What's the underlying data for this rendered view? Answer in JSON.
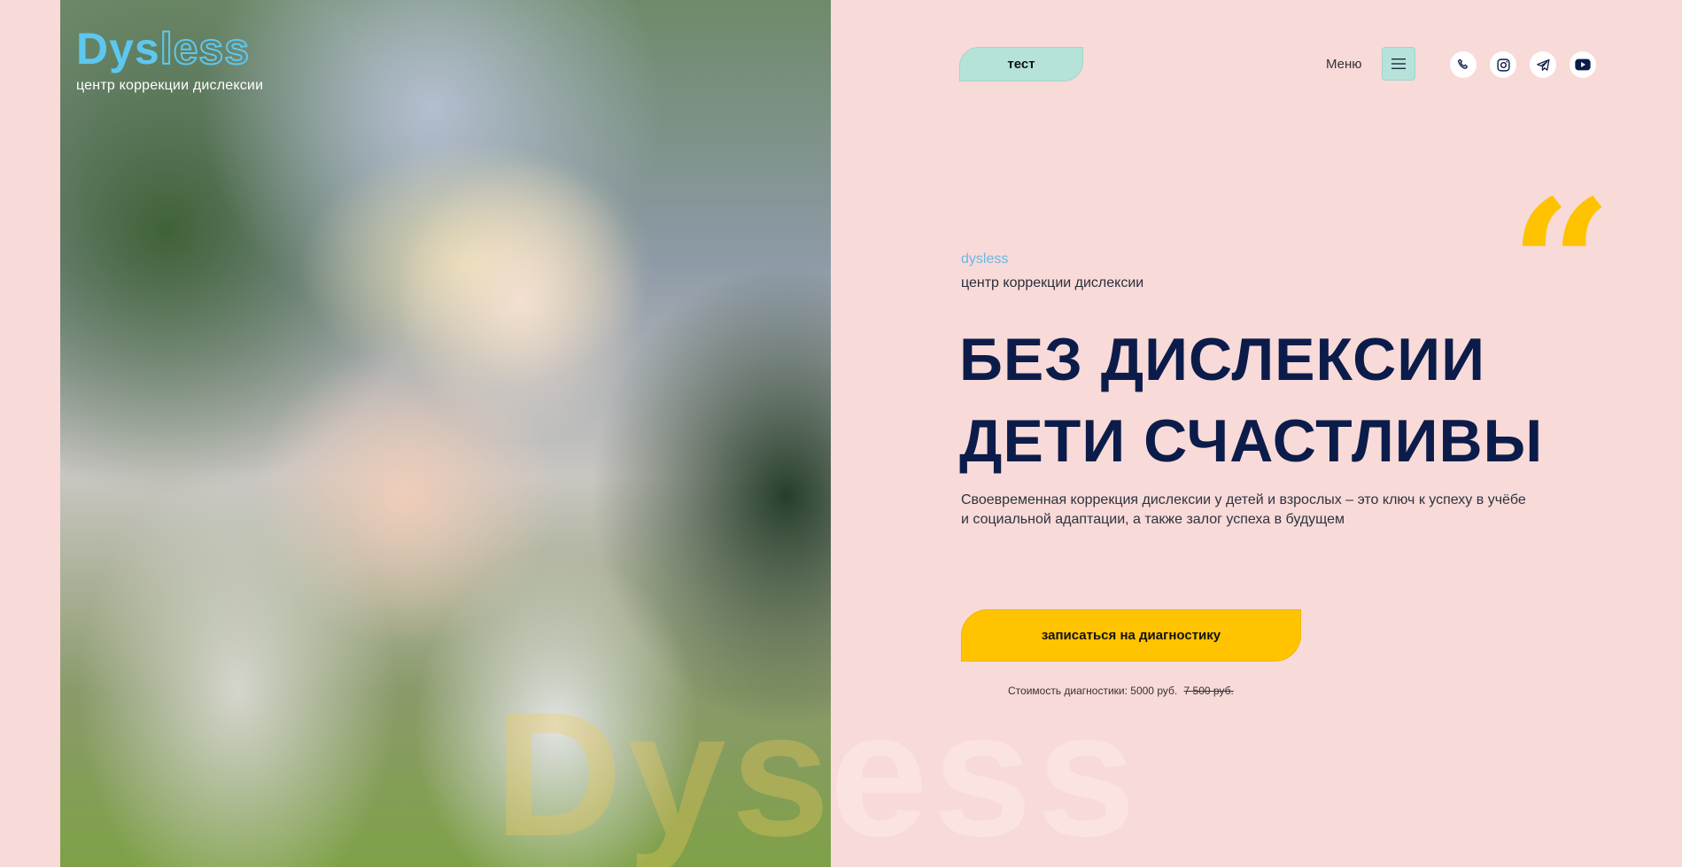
{
  "logo": {
    "word_part1": "Dys",
    "word_part2": "less",
    "subtitle": "центр коррекции дислексии"
  },
  "header": {
    "test_label": "тест",
    "menu_label": "Меню",
    "socials": [
      {
        "icon": "phone-icon"
      },
      {
        "icon": "instagram-icon"
      },
      {
        "icon": "telegram-icon"
      },
      {
        "icon": "youtube-icon"
      }
    ]
  },
  "hero": {
    "brand": "dysless",
    "brand_subtitle": "центр коррекции дислексии",
    "title_line1": "БЕЗ ДИСЛЕКСИИ",
    "title_line2": "ДЕТИ СЧАСТЛИВЫ",
    "description_line1": "Своевременная коррекция дислексии у детей и взрослых – это ключ к успеху в учёбе",
    "description_line2": "и социальной адаптации, а также залог успеха в будущем",
    "cta_label": "записаться на диагностику",
    "price_label": "Стоимость диагностики: 5000 руб.",
    "price_old": "7 500 руб."
  },
  "watermark": "Dysless",
  "colors": {
    "background": "#f8dad8",
    "accent_yellow": "#ffc300",
    "accent_mint": "#b6e3d9",
    "logo_blue": "#5cc8f0",
    "title_navy": "#0c1c4a"
  }
}
